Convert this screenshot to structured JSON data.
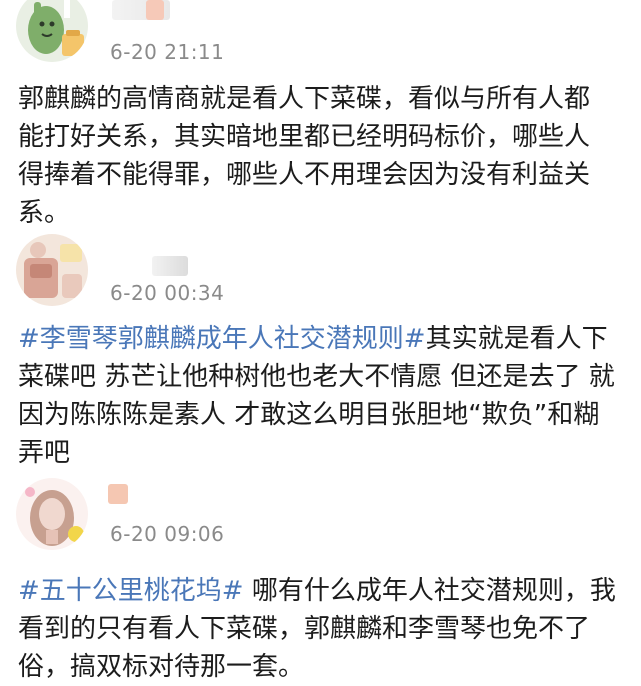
{
  "comments": [
    {
      "avatar_icon": "cartoon-cactus-avatar-icon",
      "time": "6-20 21:11",
      "lines": [
        {
          "text": "郭麒麟的高情商就是看人下菜碟，看似与所有人都"
        },
        {
          "text": "能打好关系，其实暗地里都已经明码标价，哪些人"
        },
        {
          "text": "得捧着不能得罪，哪些人不用理会因为没有利益关"
        },
        {
          "text": "系。"
        }
      ]
    },
    {
      "avatar_icon": "cartoon-bear-avatar-icon",
      "time": "6-20 00:34",
      "lines": [
        {
          "tag": "#李雪琴郭麒麟成年人社交潜规则#",
          "text": "其实就是看人下"
        },
        {
          "text": "菜碟吧 苏芒让他种树他也老大不情愿 但还是去了 就"
        },
        {
          "text": "因为陈陈陈是素人 才敢这么明目张胆地“欺负”和糊"
        },
        {
          "text": "弄吧"
        }
      ]
    },
    {
      "avatar_icon": "girl-portrait-avatar-icon",
      "time": "6-20 09:06",
      "lines": [
        {
          "tag": "#五十公里桃花坞#",
          "text": " 哪有什么成年人社交潜规则，我"
        },
        {
          "text": "看到的只有看人下菜碟，郭麒麟和李雪琴也免不了"
        },
        {
          "text": "俗，搞双标对待那一套。"
        }
      ]
    }
  ]
}
